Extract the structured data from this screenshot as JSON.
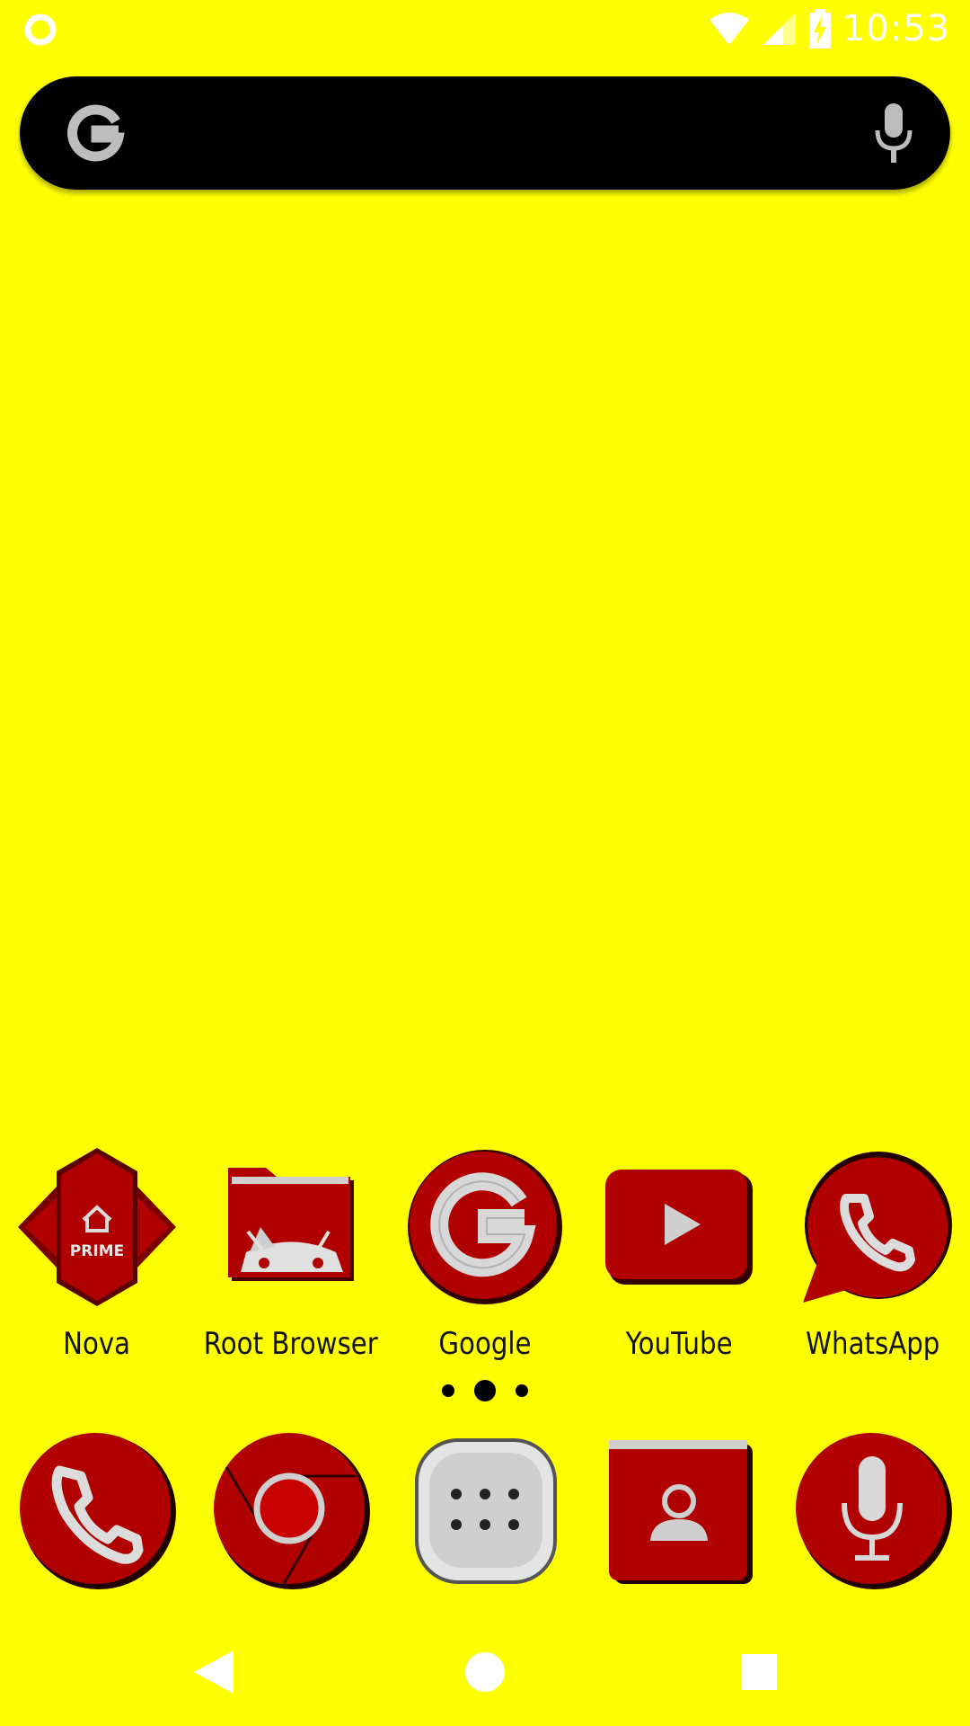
{
  "status_bar": {
    "time": "10:53",
    "icons": [
      "circle-notification-icon",
      "wifi-icon",
      "cell-signal-icon",
      "battery-charging-icon"
    ]
  },
  "search_bar": {
    "icons": [
      "google-g-icon",
      "mic-icon"
    ]
  },
  "apps_row": [
    {
      "label": "Nova",
      "icon": "nova-prime-icon"
    },
    {
      "label": "Root Browser",
      "icon": "root-browser-icon"
    },
    {
      "label": "Google",
      "icon": "google-icon"
    },
    {
      "label": "YouTube",
      "icon": "youtube-icon"
    },
    {
      "label": "WhatsApp",
      "icon": "whatsapp-icon"
    }
  ],
  "nova_icon_text": "PRIME",
  "page_indicator": {
    "count": 3,
    "active": 1
  },
  "dock": [
    {
      "icon": "phone-icon"
    },
    {
      "icon": "chrome-icon"
    },
    {
      "icon": "app-drawer-icon"
    },
    {
      "icon": "contacts-icon"
    },
    {
      "icon": "voice-recorder-icon"
    }
  ],
  "nav": [
    "back-icon",
    "home-icon",
    "recents-icon"
  ],
  "colors": {
    "wallpaper": "#FFFF00",
    "icon_red": "#B00000",
    "icon_dark_red": "#7A0000",
    "chrome_silver": "#C8C8C8"
  }
}
